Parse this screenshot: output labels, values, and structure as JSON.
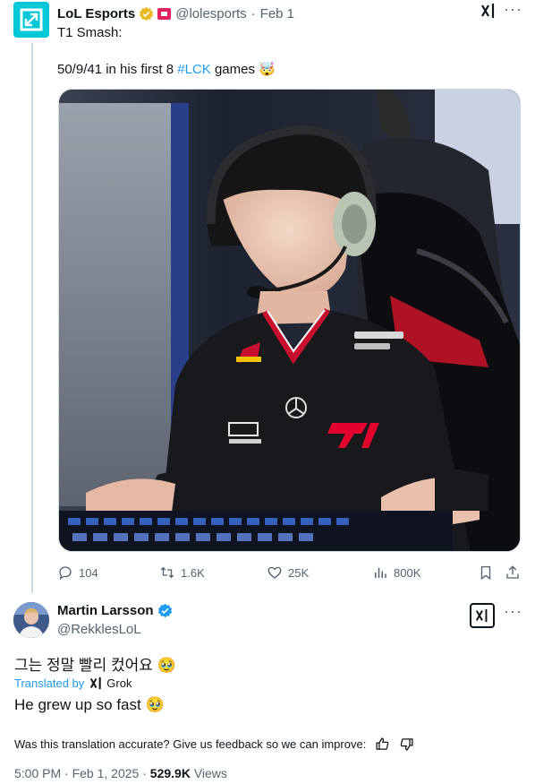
{
  "parent_tweet": {
    "author_name": "LoL Esports",
    "handle": "@lolesports",
    "separator": "·",
    "date": "Feb 1",
    "text_line1": "T1 Smash:",
    "text_line2_prefix": "50/9/41 in his first 8 ",
    "hashtag": "#LCK",
    "text_line2_suffix": " games",
    "text_line2_emoji": "🤯",
    "more": "···",
    "grok_icon": "xai-icon",
    "stats": {
      "replies": "104",
      "reposts": "1.6K",
      "likes": "25K",
      "views": "800K"
    }
  },
  "reply_tweet": {
    "author_name": "Martin Larsson",
    "handle": "@RekklesLoL",
    "more": "···",
    "original_text": "그는 정말 빨리 컸어요",
    "original_emoji": "🥹",
    "translated_by": "Translated by",
    "translator": "Grok",
    "translated_text": "He grew up so fast",
    "translated_emoji": "🥹",
    "feedback_prompt": "Was this translation accurate? Give us feedback so we can improve:",
    "time": "5:00 PM",
    "date": "Feb 1, 2025",
    "views_count": "529.9K",
    "views_label": "Views"
  },
  "colors": {
    "accent": "#1d9bf0",
    "secondary_text": "#536471",
    "primary_text": "#0f1419",
    "lol_logo_bg": "#00c8d7",
    "verified_gold": "#e8b923",
    "verified_blue": "#1d9bf0",
    "t1_red": "#e2012d"
  }
}
